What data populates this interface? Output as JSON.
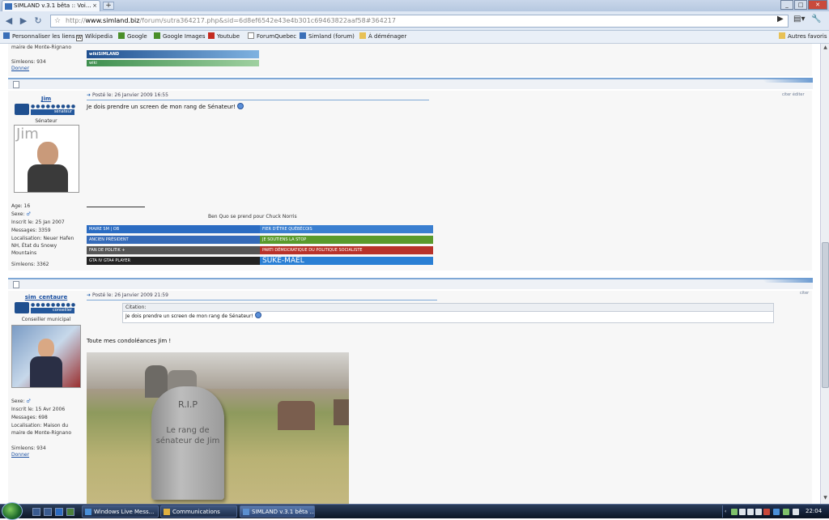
{
  "browser": {
    "tab_title": "SIMLAND v.3.1 bêta :: Voi...",
    "tab_close": "×",
    "new_tab": "+",
    "url_prefix": "http://",
    "url_host": "www.simland.biz",
    "url_path": "/forum/sutra364217.php&sid=6d8ef6542e43e4b301c69463822aaf58#364217",
    "bookmarks": [
      {
        "label": "Personnaliser les liens",
        "icon": "simland-icon"
      },
      {
        "label": "Wikipedia",
        "icon": "wikipedia-icon"
      },
      {
        "label": "Google",
        "icon": "google-icon"
      },
      {
        "label": "Google Images",
        "icon": "google-icon"
      },
      {
        "label": "Youtube",
        "icon": "youtube-icon"
      },
      {
        "label": "ForumQuebec",
        "icon": "page-icon"
      },
      {
        "label": "Simland (forum)",
        "icon": "simland-icon"
      },
      {
        "label": "À déménager",
        "icon": "folder-icon"
      }
    ],
    "other_bookmarks": "Autres favoris"
  },
  "top_fragment": {
    "location": "maire de Monte-Rignano",
    "simleons": "Simleons: 934",
    "give": "Donner",
    "banner1": "wikiSIMLAND",
    "banner2": "wiki"
  },
  "post1": {
    "username": "Jim",
    "rank_label": "sénateur",
    "rank_title": "Sénateur",
    "avatar_name": "Jim",
    "posted": "Posté le: 26 Janvier 2009 16:55",
    "controls": "citer  éditer",
    "message": "Je dois prendre un screen de mon rang de Sénateur!",
    "signature": "Ben Quo se prend pour Chuck Norris",
    "age": "Age: 16",
    "sex": "Sexe:",
    "joined": "Inscrit le: 25 Jan 2007",
    "messages": "Messages: 3359",
    "location": "Localisation: Neuer Hafen NH, État du Snowy Mountains",
    "simleons": "Simleons: 3362",
    "banners": [
      {
        "text": "MAIRE   SM | OB",
        "color": "#2b6cc2"
      },
      {
        "text": "FIER D'ÊTRE QUÉBÉCOIS",
        "color": "#3a7fd0"
      },
      {
        "text": "ANCIEN PRÉSIDENT",
        "color": "#356ab8"
      },
      {
        "text": "JE SOUTIENS LA STOP",
        "color": "#5a9a2c"
      },
      {
        "text": "FAN DE POLITIK +",
        "color": "#555555"
      },
      {
        "text": "PARTI DÉMOCRATIQUE DU POLITIQUE SOCIALISTE",
        "color": "#b8322a"
      },
      {
        "text": "GTA  IV                         GTA4 PLAYER",
        "color": "#222222"
      },
      {
        "text": "SUKE-MAEL",
        "color": "#2a7fd4"
      }
    ]
  },
  "post2": {
    "username": "sim_centaure",
    "rank_label": "conseiller",
    "rank_title": "Conseiller municipal",
    "posted": "Posté le: 26 Janvier 2009 21:59",
    "controls": "citer",
    "quote_header": "Citation:",
    "quote_text": "Je dois prendre un screen de mon rang de Sénateur!",
    "message": "Toute mes condoléances Jim !",
    "tomb_rip": "R.I.P",
    "tomb_text": "Le rang de sénateur de Jim",
    "sex": "Sexe:",
    "joined": "Inscrit le: 15 Avr 2006",
    "messages": "Messages: 698",
    "location": "Localisation: Maison du maire de Monte-Rignano",
    "simleons": "Simleons: 934",
    "give": "Donner"
  },
  "taskbar": {
    "tasks": [
      {
        "label": "Windows Live Mess...",
        "active": false
      },
      {
        "label": "Communications",
        "active": false
      },
      {
        "label": "SIMLAND v.3.1 bêta ...",
        "active": true
      }
    ],
    "clock": "22:04"
  }
}
